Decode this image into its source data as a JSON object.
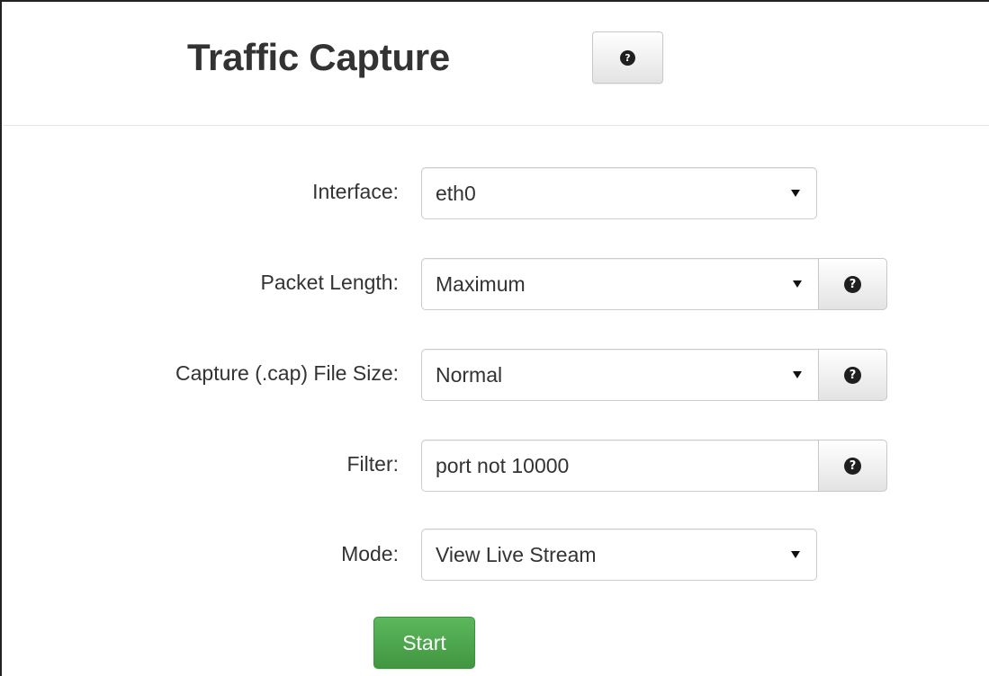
{
  "header": {
    "title": "Traffic Capture",
    "help_icon": "question-circle-icon"
  },
  "form": {
    "interface": {
      "label": "Interface:",
      "value": "eth0"
    },
    "packet_length": {
      "label": "Packet Length:",
      "value": "Maximum",
      "help_icon": "question-circle-icon"
    },
    "file_size": {
      "label": "Capture (.cap) File Size:",
      "value": "Normal",
      "help_icon": "question-circle-icon"
    },
    "filter": {
      "label": "Filter:",
      "value": "port not 10000",
      "help_icon": "question-circle-icon"
    },
    "mode": {
      "label": "Mode:",
      "value": "View Live Stream"
    },
    "start_label": "Start"
  },
  "icons": {
    "help_glyph": "?"
  },
  "colors": {
    "start_button": "#5cb85c",
    "text": "#333333"
  }
}
